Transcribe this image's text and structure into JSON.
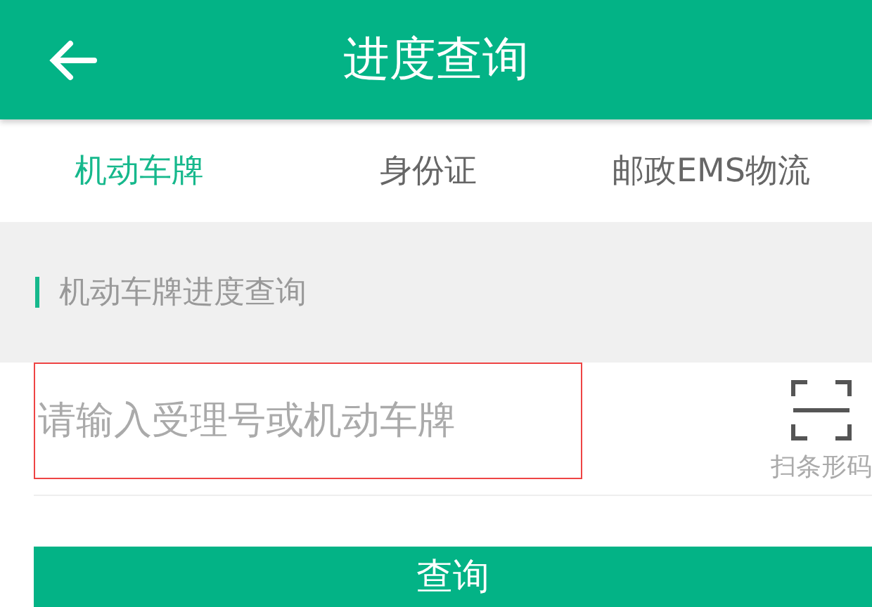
{
  "header": {
    "title": "进度查询"
  },
  "tabs": [
    {
      "label": "机动车牌",
      "selected": true
    },
    {
      "label": "身份证",
      "selected": false
    },
    {
      "label": "邮政EMS物流",
      "selected": false
    }
  ],
  "section": {
    "title": "机动车牌进度查询"
  },
  "query": {
    "placeholder": "请输入受理号或机动车牌",
    "scan_label": "扫条形码"
  },
  "buttons": [
    "查询"
  ]
}
